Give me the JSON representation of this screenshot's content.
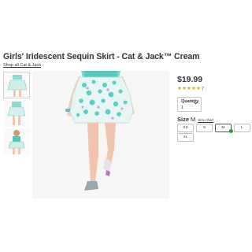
{
  "product": {
    "title": "Girls' Iridescent Sequin Skirt - Cat & Jack™ Cream",
    "brand_link": "Shop all Cat & Jack",
    "price": "$19.99",
    "rating": {
      "stars": 5,
      "max": 5,
      "review_count": "7"
    }
  },
  "quantity": {
    "label": "Quantity",
    "value": "1"
  },
  "size": {
    "label": "Size",
    "selected": "M",
    "chart_link": "Size chart",
    "options": [
      "XS",
      "S",
      "M",
      "L",
      "XL"
    ],
    "selected_index": 2
  },
  "gallery": {
    "thumbnails": 3,
    "active_thumbnail": 0
  },
  "colors": {
    "accent_in_stock": "#2e9c3a",
    "star": "#e8a400",
    "skirt_teal": "#4fc9c0"
  },
  "icons": [
    "star-icon",
    "chevron-down-icon",
    "in-stock-dot-icon"
  ]
}
